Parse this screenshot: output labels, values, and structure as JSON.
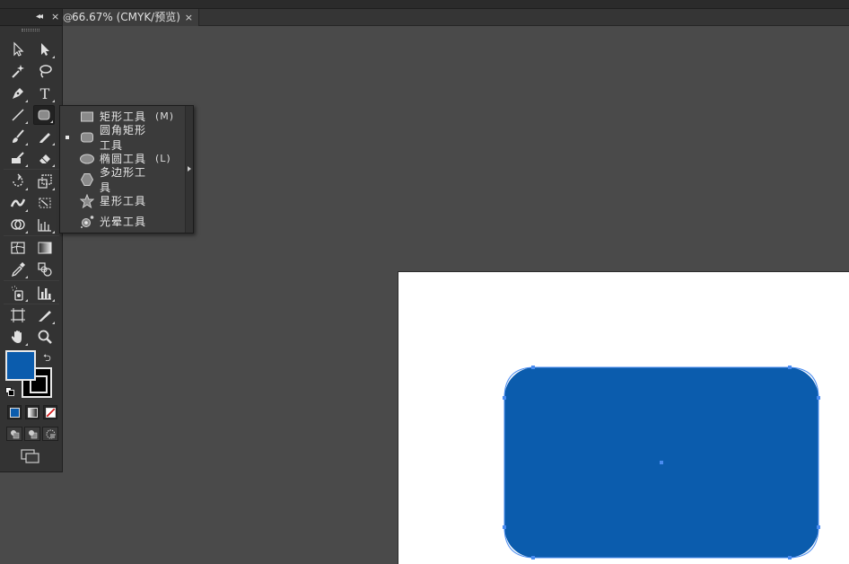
{
  "document_tab": {
    "title": "66.67% (CMYK/预览)",
    "close": "×"
  },
  "toolbar": {
    "collapse_glyph": "◂◂",
    "close_glyph": "×",
    "tools": [
      {
        "name": "selection-tool-icon"
      },
      {
        "name": "direct-selection-tool-icon"
      },
      {
        "name": "magic-wand-tool-icon"
      },
      {
        "name": "lasso-tool-icon"
      },
      {
        "name": "pen-tool-icon"
      },
      {
        "name": "type-tool-icon",
        "glyph": "T"
      },
      {
        "name": "line-segment-tool-icon"
      },
      {
        "name": "rounded-rectangle-tool-icon"
      },
      {
        "name": "paintbrush-tool-icon"
      },
      {
        "name": "pencil-tool-icon"
      },
      {
        "name": "blob-brush-tool-icon"
      },
      {
        "name": "eraser-tool-icon"
      },
      {
        "name": "rotate-tool-icon"
      },
      {
        "name": "scale-tool-icon"
      },
      {
        "name": "width-tool-icon"
      },
      {
        "name": "free-transform-tool-icon"
      },
      {
        "name": "shape-builder-tool-icon"
      },
      {
        "name": "perspective-grid-tool-icon"
      },
      {
        "name": "mesh-tool-icon"
      },
      {
        "name": "gradient-tool-icon"
      },
      {
        "name": "eyedropper-tool-icon"
      },
      {
        "name": "blend-tool-icon"
      },
      {
        "name": "symbol-sprayer-tool-icon"
      },
      {
        "name": "column-graph-tool-icon"
      },
      {
        "name": "artboard-tool-icon"
      },
      {
        "name": "slice-tool-icon"
      },
      {
        "name": "hand-tool-icon"
      },
      {
        "name": "zoom-tool-icon"
      }
    ],
    "fill_color": "#0b5cad",
    "stroke_color": "#000000"
  },
  "flyout": {
    "items": [
      {
        "label": "矩形工具",
        "shortcut": "(M)",
        "icon": "rectangle-icon",
        "selected": false
      },
      {
        "label": "圆角矩形工具",
        "shortcut": "",
        "icon": "rounded-rectangle-icon",
        "selected": true
      },
      {
        "label": "椭圆工具",
        "shortcut": "(L)",
        "icon": "ellipse-icon",
        "selected": false
      },
      {
        "label": "多边形工具",
        "shortcut": "",
        "icon": "polygon-icon",
        "selected": false
      },
      {
        "label": "星形工具",
        "shortcut": "",
        "icon": "star-icon",
        "selected": false
      },
      {
        "label": "光晕工具",
        "shortcut": "",
        "icon": "flare-icon",
        "selected": false
      }
    ]
  },
  "canvas": {
    "artboard_color": "#ffffff",
    "shape_fill": "#0b5cad",
    "selection_color": "#4a8cf0"
  }
}
